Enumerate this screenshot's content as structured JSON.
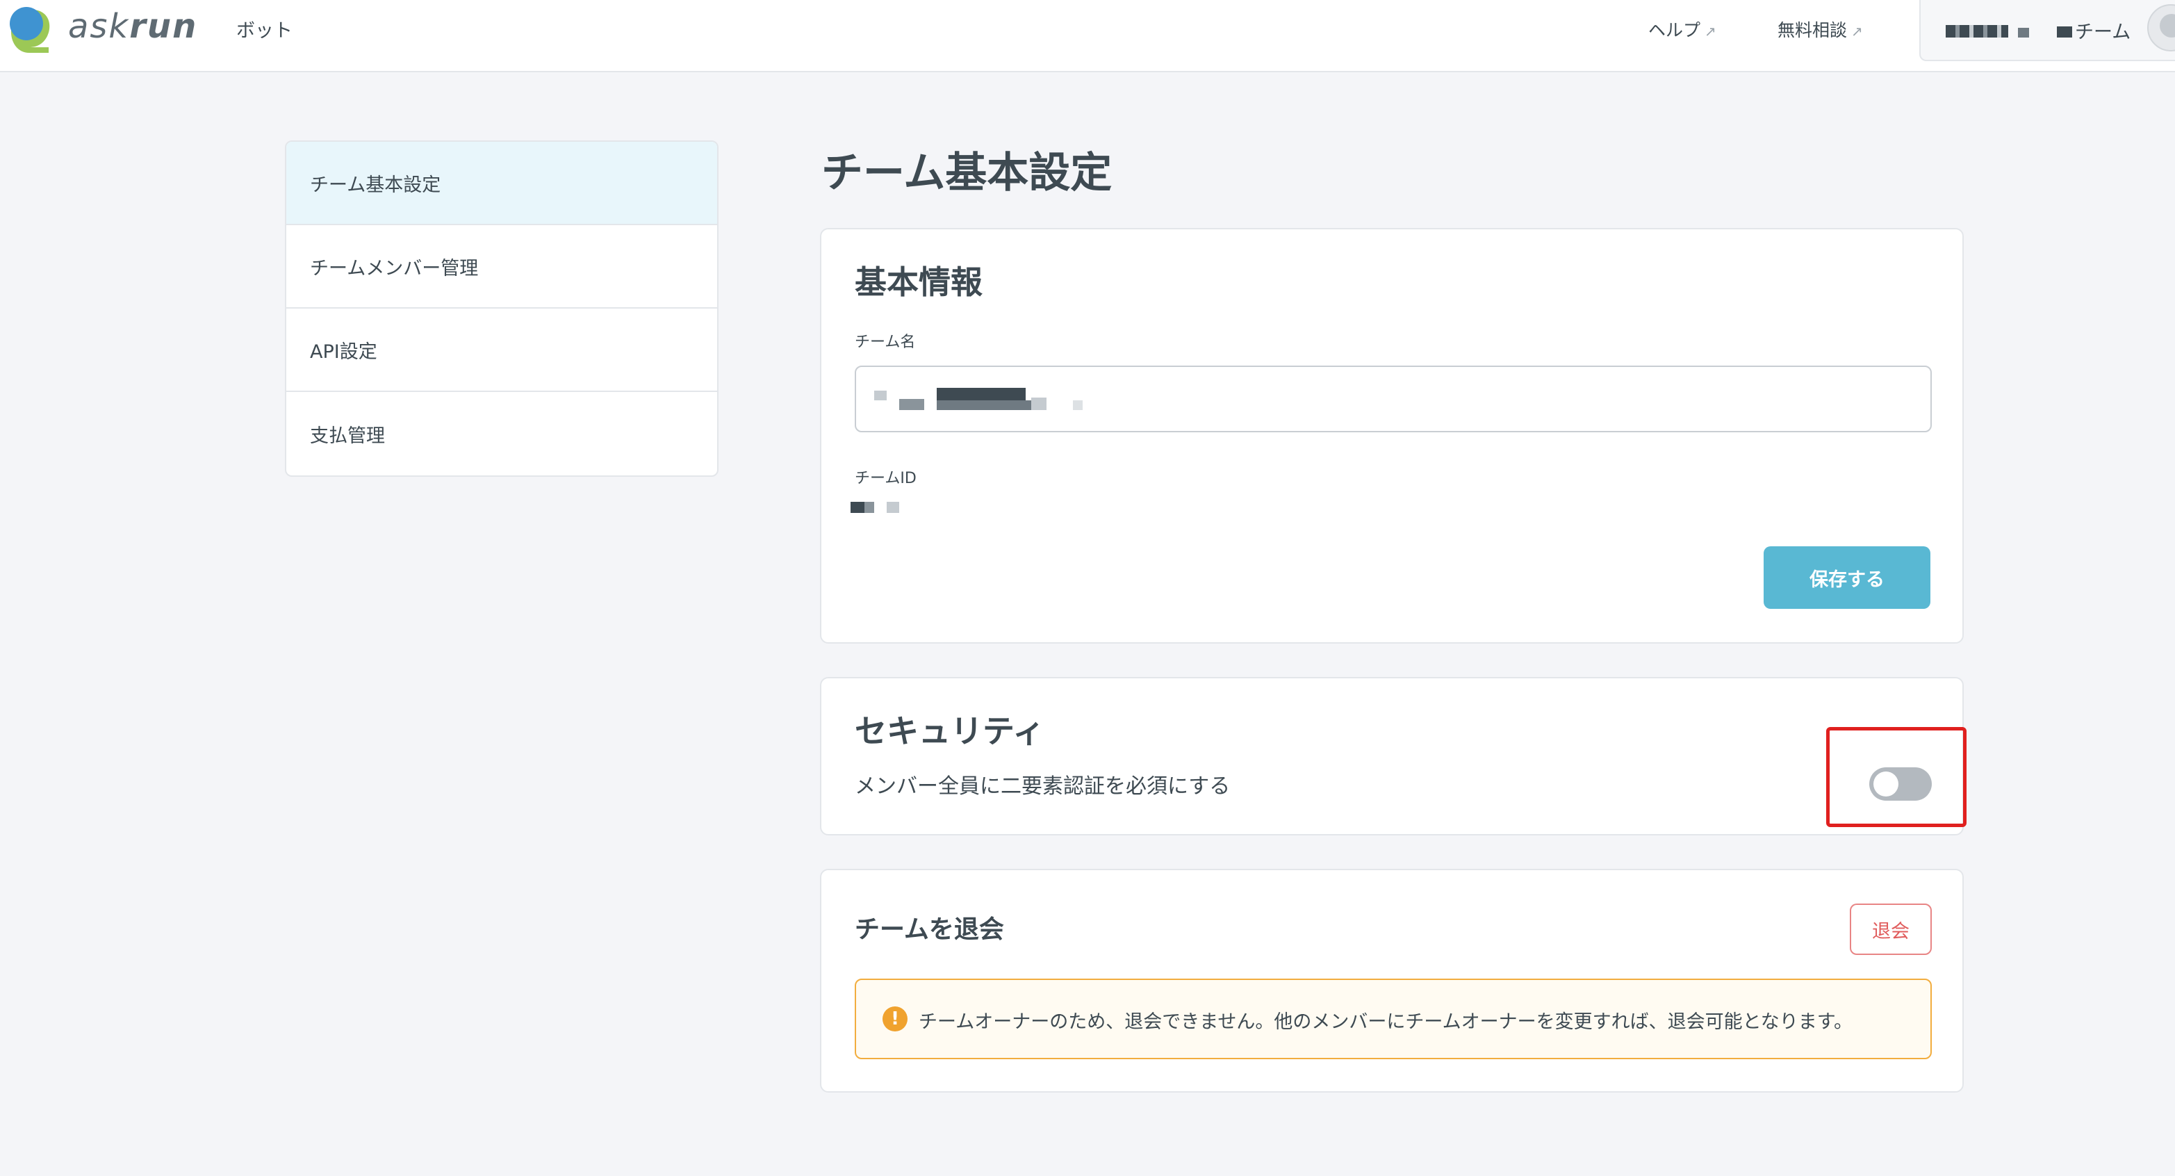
{
  "header": {
    "logo_text_light": "ask",
    "logo_text_bold": "run",
    "nav_bot": "ボット",
    "nav_help": "ヘルプ",
    "nav_consult": "無料相談",
    "external_arrow": "↗",
    "team_name": "チーム"
  },
  "sidebar": {
    "items": [
      {
        "label": "チーム基本設定",
        "active": true
      },
      {
        "label": "チームメンバー管理",
        "active": false
      },
      {
        "label": "API設定",
        "active": false
      },
      {
        "label": "支払管理",
        "active": false
      }
    ]
  },
  "main": {
    "page_title": "チーム基本設定",
    "basic_info": {
      "title": "基本情報",
      "team_name_label": "チーム名",
      "team_id_label": "チームID",
      "save_label": "保存する"
    },
    "security": {
      "title": "セキュリティ",
      "description": "メンバー全員に二要素認証を必須にする",
      "two_factor_enabled": false
    },
    "leave": {
      "title": "チームを退会",
      "leave_label": "退会",
      "warning_icon": "!",
      "warning_text": "チームオーナーのため、退会できません。他のメンバーにチームオーナーを変更すれば、退会可能となります。"
    }
  },
  "colors": {
    "accent": "#59b8d3",
    "active_nav": "#e8f6fb",
    "danger": "#e05c5c",
    "warning": "#f0a22e",
    "highlight": "#e0201f"
  }
}
